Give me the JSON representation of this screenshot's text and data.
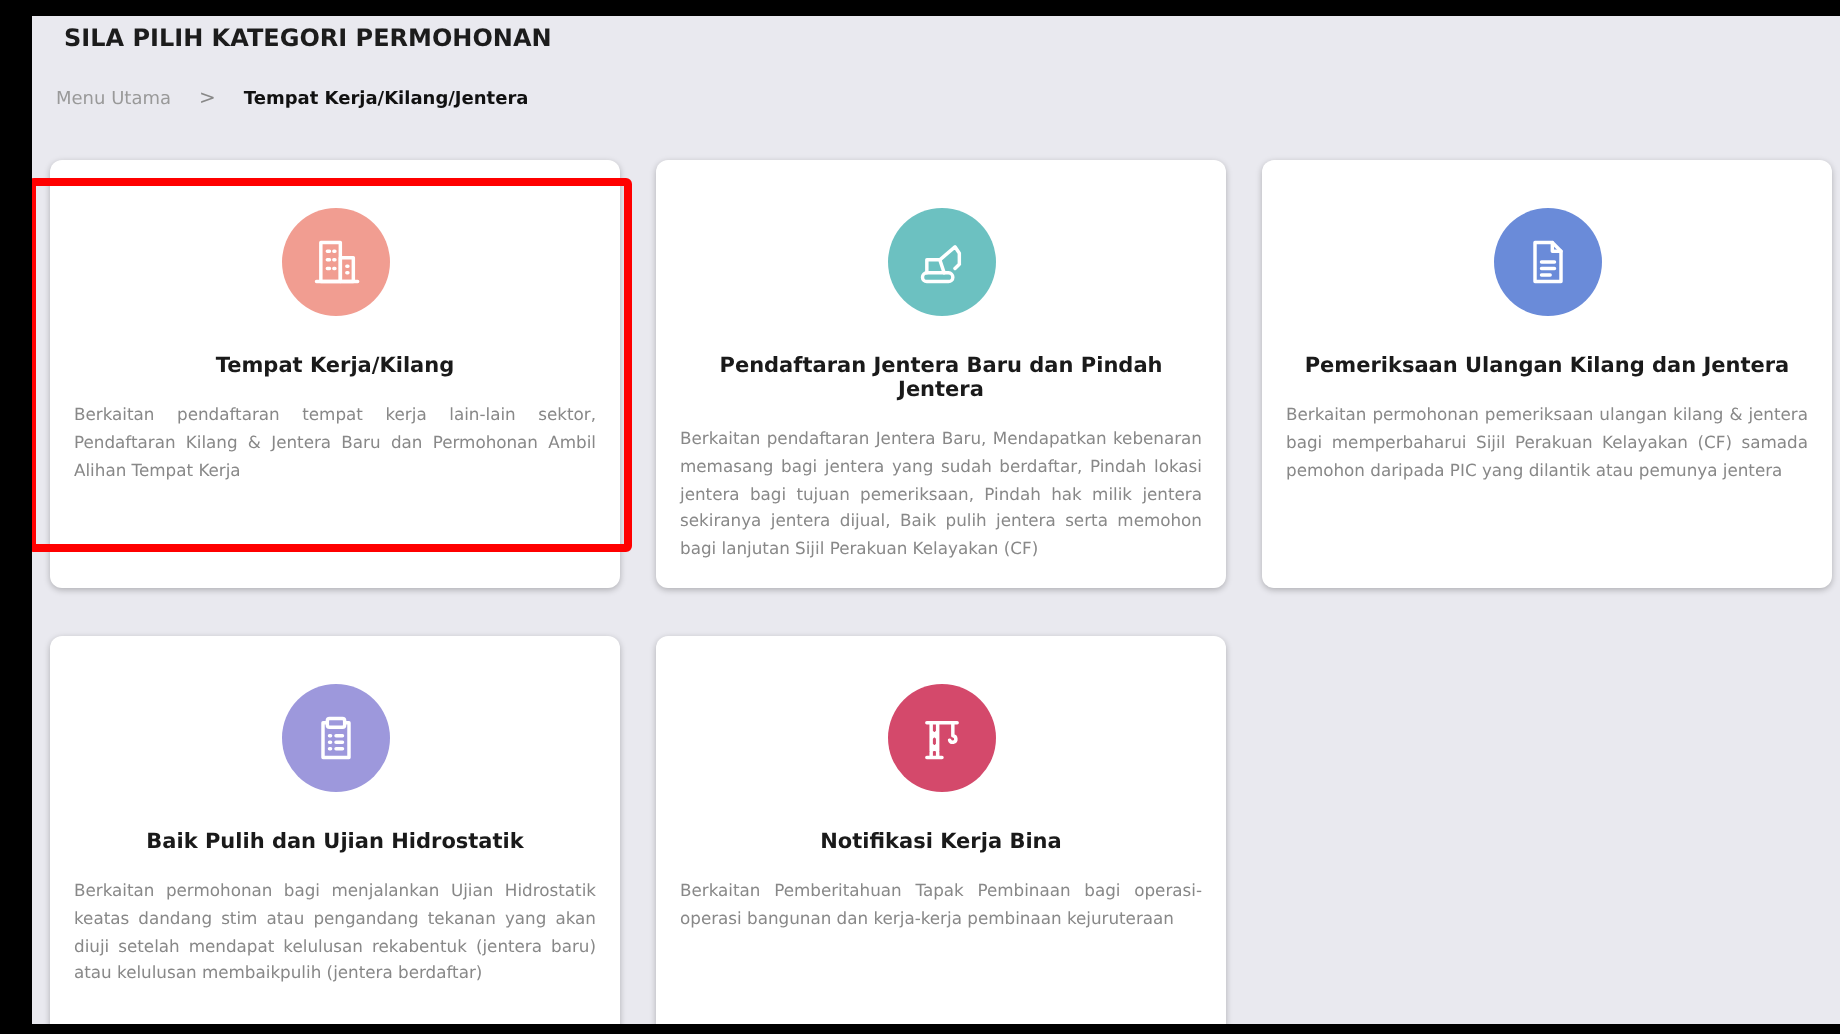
{
  "page": {
    "title": "SILA PILIH KATEGORI PERMOHONAN"
  },
  "breadcrumb": [
    {
      "label": "Menu Utama",
      "selected": false
    },
    {
      "label": "Tempat Kerja/Kilang/Jentera",
      "selected": true
    }
  ],
  "breadcrumb_separator": ">",
  "cards": [
    {
      "title": "Tempat Kerja/Kilang",
      "description": "Berkaitan pendaftaran tempat kerja lain-lain sektor, Pendaftaran Kilang & Jentera Baru dan Permohonan Ambil Alihan Tempat Kerja",
      "color": "#f19d91",
      "highlighted": true
    },
    {
      "title": "Pendaftaran Jentera Baru dan Pindah Jentera",
      "description": "Berkaitan pendaftaran Jentera Baru, Mendapatkan kebenaran memasang bagi jentera yang sudah berdaftar, Pindah lokasi jentera bagi tujuan pemeriksaan, Pindah hak milik jentera sekiranya jentera dijual, Baik pulih jentera serta memohon bagi lanjutan Sijil Perakuan Kelayakan (CF)",
      "color": "#6cc1c1",
      "highlighted": false
    },
    {
      "title": "Pemeriksaan Ulangan Kilang dan Jentera",
      "description": "Berkaitan permohonan pemeriksaan ulangan kilang & jentera bagi memperbaharui Sijil Perakuan Kelayakan (CF) samada pemohon daripada PIC yang dilantik atau pemunya jentera",
      "color": "#6a8bd9",
      "highlighted": false
    },
    {
      "title": "Baik Pulih dan Ujian Hidrostatik",
      "description": "Berkaitan permohonan bagi menjalankan Ujian Hidrostatik keatas dandang stim atau pengandang tekanan yang akan diuji setelah mendapat kelulusan rekabentuk (jentera baru) atau kelulusan membaikpulih (jentera berdaftar)",
      "color": "#9d98dc",
      "highlighted": false
    },
    {
      "title": "Notifikasi Kerja Bina",
      "description": "Berkaitan Pemberitahuan Tapak Pembinaan bagi operasi-operasi bangunan dan kerja-kerja pembinaan kejuruteraan",
      "color": "#d4496b",
      "highlighted": false
    }
  ]
}
